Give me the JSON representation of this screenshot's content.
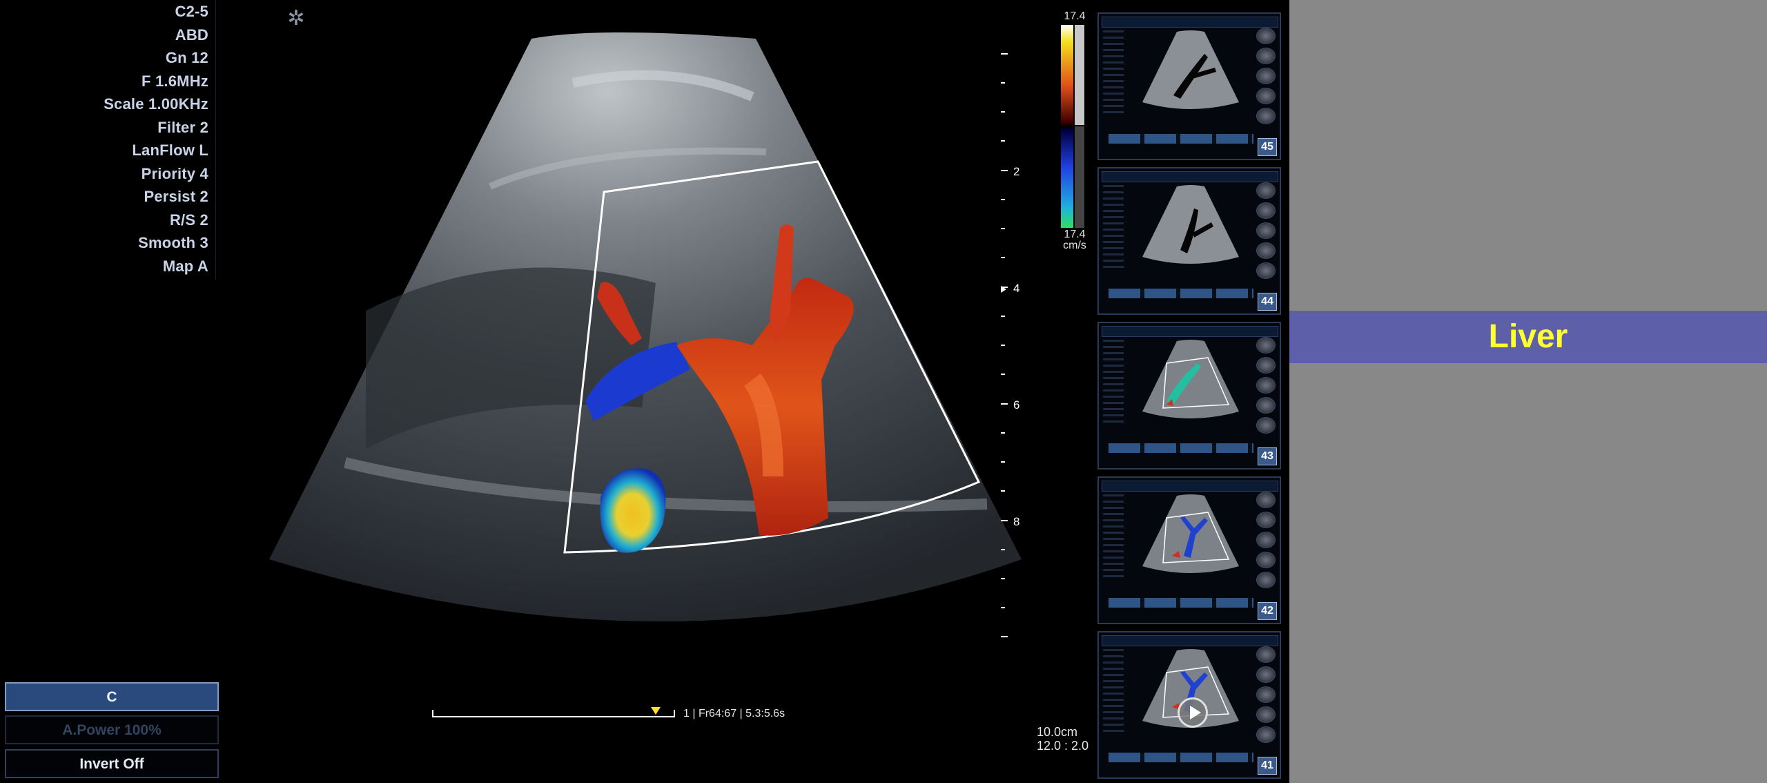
{
  "params": [
    "C2-5",
    "ABD",
    "Gn 12",
    "F 1.6MHz",
    "Scale 1.00KHz",
    "Filter 2",
    "LanFlow L",
    "Priority 4",
    "Persist 2",
    "R/S 2",
    "Smooth 3",
    "Map A"
  ],
  "buttons": {
    "mode": "C",
    "power": "A.Power 100%",
    "invert": "Invert  Off"
  },
  "color_bar": {
    "top": "17.4",
    "bottom": "17.4",
    "unit": "cm/s"
  },
  "depth_marks": [
    "2",
    "4",
    "6",
    "8"
  ],
  "cine": {
    "frame_info": "1 | Fr64:67 | 5.3:5.6s"
  },
  "depth_info": {
    "depth": "10.0cm",
    "ratio": "12.0 : 2.0"
  },
  "thumbnails": [
    {
      "number": "45",
      "type": "bmode"
    },
    {
      "number": "44",
      "type": "bmode"
    },
    {
      "number": "43",
      "type": "color"
    },
    {
      "number": "42",
      "type": "color"
    },
    {
      "number": "41",
      "type": "video"
    }
  ],
  "banner": {
    "label": "Liver"
  },
  "colors": {
    "banner_bg": "#5d5fa8",
    "banner_text": "#ffff33",
    "panel_bg": "#888888",
    "active_button": "#2a4a7d"
  }
}
